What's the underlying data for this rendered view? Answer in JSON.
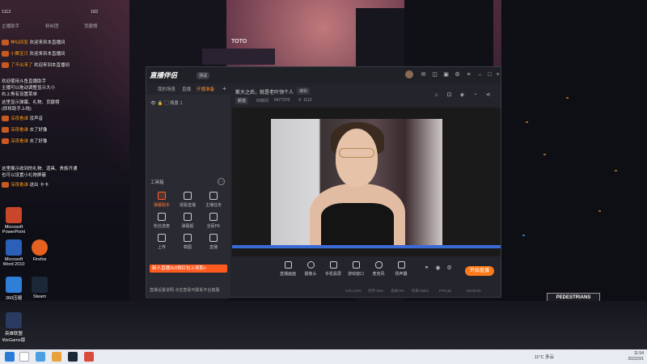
{
  "chat": {
    "top_counts": [
      "1112",
      "182"
    ],
    "labels": [
      "主播助手",
      "粉丝团",
      "贡献榜"
    ],
    "lines": [
      {
        "user": "神仙回复",
        "text": "欢迎来到本直播间"
      },
      {
        "user": "小舞宝贝",
        "text": "欢迎来到本直播间"
      },
      {
        "user": "了不出来了",
        "text": "欢迎来到本直播间"
      },
      {
        "user": "",
        "text": "欢迎使用斗鱼直播助手"
      },
      {
        "user": "",
        "text": "主播可以拖动调整显示大小"
      },
      {
        "user": "",
        "text": "右上角有设置菜单"
      },
      {
        "user": "",
        "text": "这里显示弹幕、礼物、贡献榜"
      },
      {
        "user": "",
        "text": "(即将助手上线)"
      },
      {
        "user": "深夜看谁",
        "text": "没声音"
      },
      {
        "user": "深夜看谁",
        "text": "去了好像"
      },
      {
        "user": "深夜看谁",
        "text": "去了好像"
      },
      {
        "user": "",
        "text": "这里展示收到的礼物、道具、贵族开通"
      },
      {
        "user": "",
        "text": "也可以设置小礼物屏蔽"
      },
      {
        "user": "深夜看谁",
        "text": "送出 卡卡"
      }
    ]
  },
  "desktop_icons": [
    {
      "label": "Microsoft PowerPoint",
      "color": "#c8472a"
    },
    {
      "label": "Microsoft Word 2010",
      "color": "#2b5fb8"
    },
    {
      "label": "Firefox",
      "color": "#e66020"
    },
    {
      "label": "360压缩",
      "color": "#2f7fd8"
    },
    {
      "label": "Steam",
      "color": "#1b2838"
    },
    {
      "label": "英雄联盟 WeGame版",
      "color": "#2a3a60"
    }
  ],
  "app": {
    "title": "直播伴侣",
    "version": "测试",
    "tabs": [
      "我的场景",
      "直播",
      "开播准备"
    ],
    "active_tab_index": 2,
    "scenes": [
      "场景 1"
    ],
    "tool_section_title": "工具箱",
    "tools": [
      {
        "label": "弹幕助手",
        "hot": true
      },
      {
        "label": "观看直播",
        "hot": false
      },
      {
        "label": "主播任务",
        "hot": false
      },
      {
        "label": "粉丝连麦",
        "hot": false
      },
      {
        "label": "弹幕姬",
        "hot": false
      },
      {
        "label": "全民PK",
        "hot": false
      },
      {
        "label": "上传",
        "hot": false
      },
      {
        "label": "截图",
        "hot": false
      },
      {
        "label": "直播",
        "hot": false
      }
    ],
    "promo_text": "新人直播3v3领红包上领取>",
    "notice_text": "直播设置说明 点击查看可联系平台客服",
    "room": {
      "title": "斯大之后，就是老叶领个人",
      "tag": "编辑",
      "category": "颜值",
      "id_label": "ID房间",
      "id_value": "6477370",
      "viewers": "1112"
    },
    "bottom_tools": [
      "直播画面",
      "摄像头",
      "手机投屏",
      "游戏窗口",
      "麦克风",
      "扬声器"
    ],
    "go_live": "开始直播",
    "status": [
      "CPU:20%",
      "内存:35%",
      "丢帧:0%",
      "码率:0kb/s",
      "FPS:30",
      "00:00:00"
    ]
  },
  "taskbar": {
    "weather": "11°C 多云",
    "time": "11:54",
    "date": "2022/3/1"
  }
}
